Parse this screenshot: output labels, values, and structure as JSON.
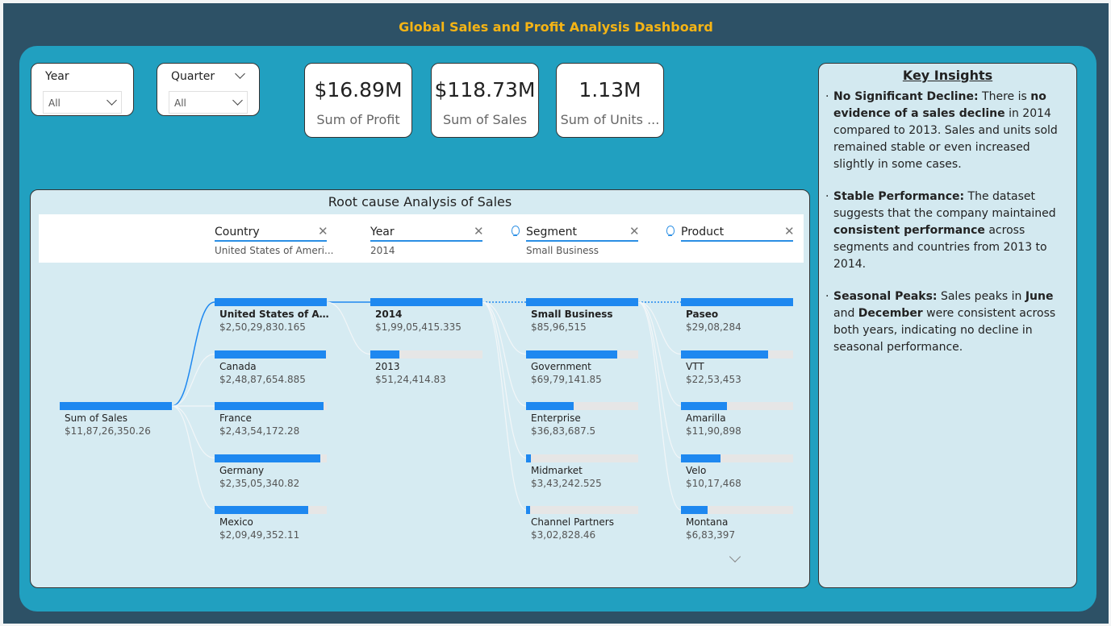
{
  "title": "Global Sales and Profit Analysis Dashboard",
  "slicers": {
    "year": {
      "label": "Year",
      "value": "All"
    },
    "quarter": {
      "label": "Quarter",
      "value": "All"
    }
  },
  "cards": [
    {
      "value": "$16.89M",
      "caption": "Sum of Profit"
    },
    {
      "value": "$118.73M",
      "caption": "Sum of  Sales"
    },
    {
      "value": "1.13M",
      "caption": "Sum of Units ..."
    }
  ],
  "insights": {
    "heading": "Key Insights",
    "items": [
      {
        "lead": "No Significant Decline:",
        "t1": " There is ",
        "b1": "no evidence of a sales decline",
        "t2": " in 2014 compared to 2013. Sales and units sold remained stable or even increased slightly in some cases."
      },
      {
        "lead": "Stable Performance:",
        "t1": " The dataset suggests that the company maintained ",
        "b1": "consistent performance",
        "t2": " across segments and countries from 2013 to 2014."
      },
      {
        "lead": "Seasonal Peaks:",
        "t1": " Sales peaks in ",
        "b1": "June",
        "t2": " and ",
        "b2": "December",
        "t3": " were consistent across both years, indicating no decline in seasonal performance."
      }
    ]
  },
  "decomposition": {
    "title": "Root cause Analysis of Sales",
    "columns": [
      {
        "name": "Country",
        "filter": "United States of Ameri..."
      },
      {
        "name": "Year",
        "filter": "2014"
      },
      {
        "name": "Segment",
        "filter": "Small Business"
      },
      {
        "name": "Product",
        "filter": ""
      }
    ],
    "root": {
      "label": "Sum of Sales",
      "value": "$11,87,26,350.26",
      "fraction": 1.0
    },
    "levels": [
      [
        {
          "label": "United States of Am...",
          "value": "$2,50,29,830.165",
          "fraction": 1.0,
          "selected": true
        },
        {
          "label": "Canada",
          "value": "$2,48,87,654.885",
          "fraction": 0.994
        },
        {
          "label": "France",
          "value": "$2,43,54,172.28",
          "fraction": 0.973
        },
        {
          "label": "Germany",
          "value": "$2,35,05,340.82",
          "fraction": 0.939
        },
        {
          "label": "Mexico",
          "value": "$2,09,49,352.11",
          "fraction": 0.837
        }
      ],
      [
        {
          "label": "2014",
          "value": "$1,99,05,415.335",
          "fraction": 1.0,
          "selected": true
        },
        {
          "label": "2013",
          "value": "$51,24,414.83",
          "fraction": 0.257
        }
      ],
      [
        {
          "label": "Small Business",
          "value": "$85,96,515",
          "fraction": 1.0,
          "selected": true
        },
        {
          "label": "Government",
          "value": "$69,79,141.85",
          "fraction": 0.812
        },
        {
          "label": "Enterprise",
          "value": "$36,83,687.5",
          "fraction": 0.428
        },
        {
          "label": "Midmarket",
          "value": "$3,43,242.525",
          "fraction": 0.04
        },
        {
          "label": "Channel Partners",
          "value": "$3,02,828.46",
          "fraction": 0.035
        }
      ],
      [
        {
          "label": "Paseo",
          "value": "$29,08,284",
          "fraction": 1.0,
          "selected": true
        },
        {
          "label": "VTT",
          "value": "$22,53,453",
          "fraction": 0.775
        },
        {
          "label": "Amarilla",
          "value": "$11,90,898",
          "fraction": 0.409
        },
        {
          "label": "Velo",
          "value": "$10,17,468",
          "fraction": 0.35
        },
        {
          "label": "Montana",
          "value": "$6,83,397",
          "fraction": 0.235
        }
      ]
    ]
  },
  "colors": {
    "accent": "#1e88f0",
    "title": "#f5b415",
    "panel": "#21a0c0",
    "background": "#2d5166"
  }
}
